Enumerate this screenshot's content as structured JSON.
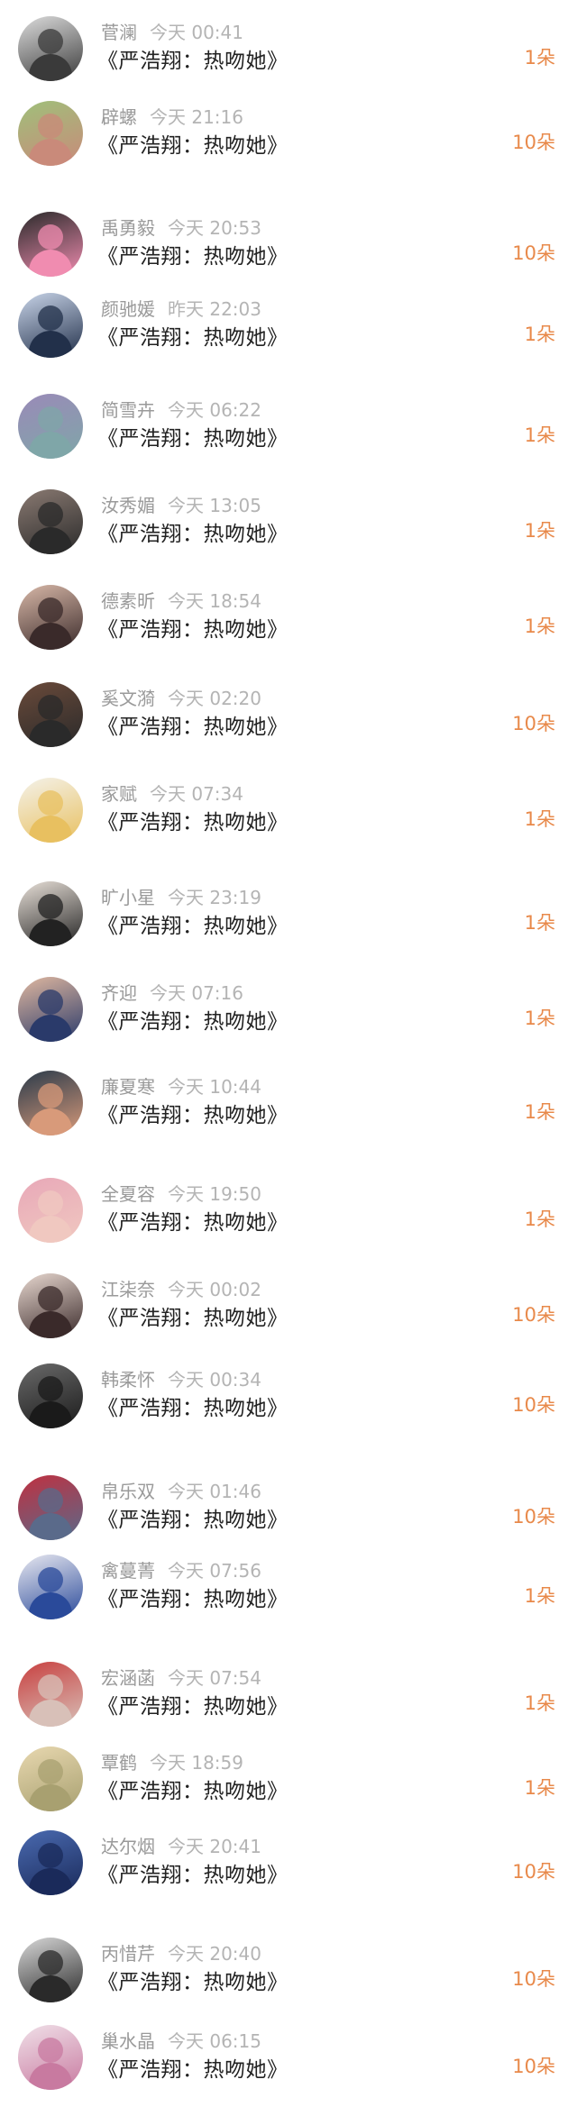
{
  "gifts": [
    {
      "name": "菅澜",
      "time": "今天 00:41",
      "song": "《严浩翔：热吻她》",
      "count": "1朵",
      "c1": "#3a3a3a",
      "c2": "#dcdcdc"
    },
    {
      "name": "辟螺",
      "time": "今天 21:16",
      "song": "《严浩翔：热吻她》",
      "count": "10朵",
      "c1": "#c98a7a",
      "c2": "#9fc07a"
    },
    {
      "name": "禹勇毅",
      "time": "今天 20:53",
      "song": "《严浩翔：热吻她》",
      "count": "10朵",
      "c1": "#f08cb0",
      "c2": "#2a2a2a"
    },
    {
      "name": "颜驰媛",
      "time": "昨天 22:03",
      "song": "《严浩翔：热吻她》",
      "count": "1朵",
      "c1": "#22304a",
      "c2": "#c8d4e8"
    },
    {
      "name": "简雪卉",
      "time": "今天 06:22",
      "song": "《严浩翔：热吻她》",
      "count": "1朵",
      "c1": "#7fa6a8",
      "c2": "#9a8ab8"
    },
    {
      "name": "汝秀媚",
      "time": "今天 13:05",
      "song": "《严浩翔：热吻她》",
      "count": "1朵",
      "c1": "#2a2a2a",
      "c2": "#8a7a72"
    },
    {
      "name": "德素昕",
      "time": "今天 18:54",
      "song": "《严浩翔：热吻她》",
      "count": "1朵",
      "c1": "#3a2a2a",
      "c2": "#d8b8a8"
    },
    {
      "name": "奚文漪",
      "time": "今天 02:20",
      "song": "《严浩翔：热吻她》",
      "count": "10朵",
      "c1": "#2a2a2a",
      "c2": "#6a4a3a"
    },
    {
      "name": "家赋",
      "time": "今天 07:34",
      "song": "《严浩翔：热吻她》",
      "count": "1朵",
      "c1": "#e8c060",
      "c2": "#f4f2ea"
    },
    {
      "name": "旷小星",
      "time": "今天 23:19",
      "song": "《严浩翔：热吻她》",
      "count": "1朵",
      "c1": "#222222",
      "c2": "#e8e0d8"
    },
    {
      "name": "齐迎",
      "time": "今天 07:16",
      "song": "《严浩翔：热吻她》",
      "count": "1朵",
      "c1": "#2a3a6a",
      "c2": "#e0b8a0"
    },
    {
      "name": "廉夏寒",
      "time": "今天 10:44",
      "song": "《严浩翔：热吻她》",
      "count": "1朵",
      "c1": "#d89a7a",
      "c2": "#2a3a4a"
    },
    {
      "name": "全夏容",
      "time": "今天 19:50",
      "song": "《严浩翔：热吻她》",
      "count": "1朵",
      "c1": "#f0c8c0",
      "c2": "#e8a8b8"
    },
    {
      "name": "江柒奈",
      "time": "今天 00:02",
      "song": "《严浩翔：热吻她》",
      "count": "10朵",
      "c1": "#3a2a2a",
      "c2": "#e8d8d0"
    },
    {
      "name": "韩柔怀",
      "time": "今天 00:34",
      "song": "《严浩翔：热吻她》",
      "count": "10朵",
      "c1": "#1a1a1a",
      "c2": "#6a6a6a"
    },
    {
      "name": "帛乐双",
      "time": "今天 01:46",
      "song": "《严浩翔：热吻她》",
      "count": "10朵",
      "c1": "#5a6a8a",
      "c2": "#c03040"
    },
    {
      "name": "禽蔓菁",
      "time": "今天 07:56",
      "song": "《严浩翔：热吻她》",
      "count": "1朵",
      "c1": "#2a4a9a",
      "c2": "#e8e8f0"
    },
    {
      "name": "宏涵菡",
      "time": "今天 07:54",
      "song": "《严浩翔：热吻她》",
      "count": "1朵",
      "c1": "#d8c0b8",
      "c2": "#c84040"
    },
    {
      "name": "覃鹤",
      "time": "今天 18:59",
      "song": "《严浩翔：热吻她》",
      "count": "1朵",
      "c1": "#a8a070",
      "c2": "#e8d8b0"
    },
    {
      "name": "达尔烟",
      "time": "今天 20:41",
      "song": "《严浩翔：热吻她》",
      "count": "10朵",
      "c1": "#1a2a5a",
      "c2": "#4a6ab0"
    },
    {
      "name": "丙惜芹",
      "time": "今天 20:40",
      "song": "《严浩翔：热吻她》",
      "count": "10朵",
      "c1": "#2a2a2a",
      "c2": "#d8d8d8"
    },
    {
      "name": "巢水晶",
      "time": "今天 06:15",
      "song": "《严浩翔：热吻她》",
      "count": "10朵",
      "c1": "#c87aa0",
      "c2": "#f0e0e8"
    }
  ]
}
